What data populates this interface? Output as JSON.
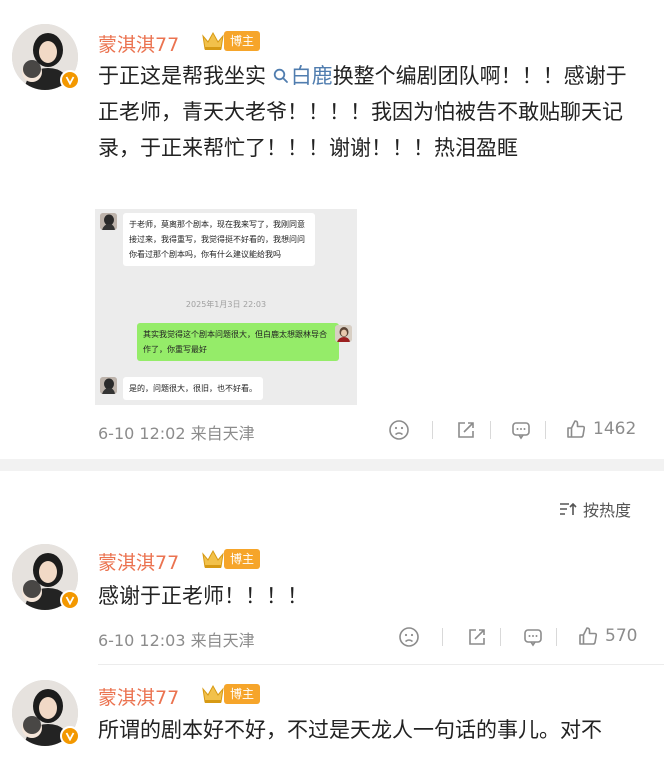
{
  "comments": [
    {
      "username": "蒙淇淇77",
      "badge": "博主",
      "text_before_topic": "于正这是帮我坐实 ",
      "topic": "白鹿",
      "text_after_topic": "换整个编剧团队啊！！！感谢于正老师，青天大老爷！！！！我因为怕被告不敢贴聊天记录，于正来帮忙了！！！谢谢！！！热泪盈眶",
      "time": "6-10 12:02",
      "location": "来自天津",
      "likes": "1462",
      "chat_screenshot": {
        "msg1": "于老师，莫离那个剧本，现在我来写了，我刚同意接过来，我得重写，我觉得挺不好看的，我想问问你看过那个剧本吗，你有什么建议能给我吗",
        "timestamp": "2025年1月3日 22:03",
        "msg2": "其实我觉得这个剧本问题很大，但白鹿太想跟林导合作了，你重写最好",
        "msg3": "是的，问题很大，很旧，也不好看。"
      }
    },
    {
      "username": "蒙淇淇77",
      "badge": "博主",
      "text": "感谢于正老师！！！！",
      "time": "6-10 12:03",
      "location": "来自天津",
      "likes": "570"
    },
    {
      "username": "蒙淇淇77",
      "badge": "博主",
      "text": "所谓的剧本好不好，不过是天龙人一句话的事儿。对不"
    }
  ],
  "sort": {
    "label": "按热度"
  },
  "colors": {
    "username": "#eb7350",
    "link": "#507daf",
    "badge": "#f6a52a",
    "meta": "#8c8c8c"
  }
}
